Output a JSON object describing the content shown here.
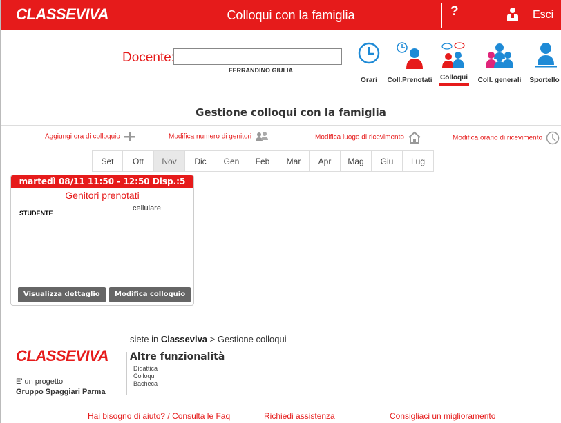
{
  "header": {
    "logo": "CLASSEVIVA",
    "title": "Colloqui con la famiglia",
    "help_label": "?",
    "logout_label": "Esci"
  },
  "teacher": {
    "label": "Docente:",
    "input_value": "",
    "name": "FERRANDINO GIULIA"
  },
  "nav": [
    {
      "label": "Orari",
      "icon": "clock-icon"
    },
    {
      "label": "Coll.Prenotati",
      "icon": "booked-user-icon"
    },
    {
      "label": "Colloqui",
      "icon": "meeting-icon",
      "active": true
    },
    {
      "label": "Coll. generali",
      "icon": "group-icon"
    },
    {
      "label": "Sportello",
      "icon": "single-user-icon"
    }
  ],
  "page_title": "Gestione colloqui con la famiglia",
  "actions": [
    {
      "label": "Aggiungi ora di colloquio",
      "icon": "plus-icon"
    },
    {
      "label": "Modifica numero di genitori",
      "icon": "people-icon"
    },
    {
      "label": "Modifica luogo di ricevimento",
      "icon": "home-icon"
    },
    {
      "label": "Modifica orario di ricevimento",
      "icon": "clock-icon"
    }
  ],
  "months": [
    "Set",
    "Ott",
    "Nov",
    "Dic",
    "Gen",
    "Feb",
    "Mar",
    "Apr",
    "Mag",
    "Giu",
    "Lug"
  ],
  "active_month": "Nov",
  "slot": {
    "header": "martedì  08/11  11:50 - 12:50   Disp.:5",
    "subtitle": "Genitori prenotati",
    "col_phone": "cellulare",
    "col_student": "STUDENTE",
    "btn_detail": "Visualizza dettaglio",
    "btn_edit": "Modifica colloquio"
  },
  "footer": {
    "breadcrumb_prefix": "siete in ",
    "breadcrumb_root": "Classeviva",
    "breadcrumb_rest": " > Gestione colloqui",
    "logo": "CLASSEVIVA",
    "altre_title": "Altre funzionalità",
    "links": [
      "Didattica",
      "Colloqui",
      "Bacheca"
    ],
    "project_text": "E' un progetto",
    "company": "Gruppo Spaggiari Parma",
    "help_link": "Hai bisogno di aiuto? / Consulta le Faq",
    "assist_link": "Richiedi assistenza",
    "improve_link": "Consigliaci un miglioramento"
  },
  "colors": {
    "brand_red": "#e61b1b",
    "nav_blue": "#1e8ad6",
    "nav_pink": "#e0257a",
    "button_gray": "#666666"
  }
}
